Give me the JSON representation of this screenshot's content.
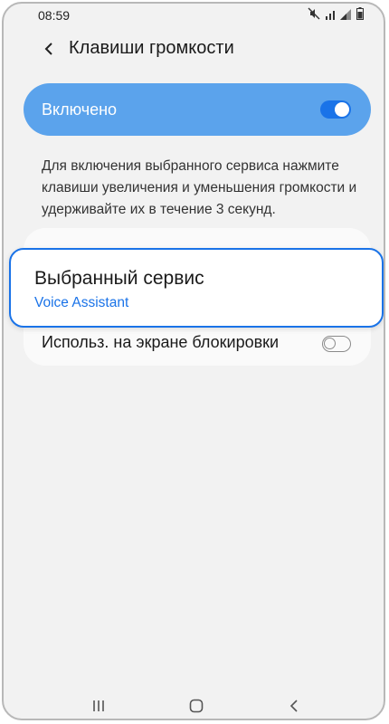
{
  "status_bar": {
    "time": "08:59",
    "icons": [
      "mute-icon",
      "wifi-icon",
      "signal-icon",
      "battery-icon"
    ]
  },
  "header": {
    "title": "Клавиши громкости",
    "back_icon": "chevron-left-icon"
  },
  "master_switch": {
    "label": "Включено",
    "enabled": true
  },
  "description": "Для включения выбранного сервиса нажмите клавиши увеличения и уменьшения громкости и удерживайте их в течение 3 секунд.",
  "selected_service": {
    "title": "Выбранный сервис",
    "value": "Voice Assistant"
  },
  "lock_screen": {
    "label": "Использ. на экране блокировки",
    "enabled": false
  },
  "navbar": {
    "icons": [
      "recents-icon",
      "home-icon",
      "back-icon"
    ]
  },
  "colors": {
    "accent": "#1a73e8",
    "master_bg": "#5ba3ec",
    "background": "#f2f2f2"
  }
}
